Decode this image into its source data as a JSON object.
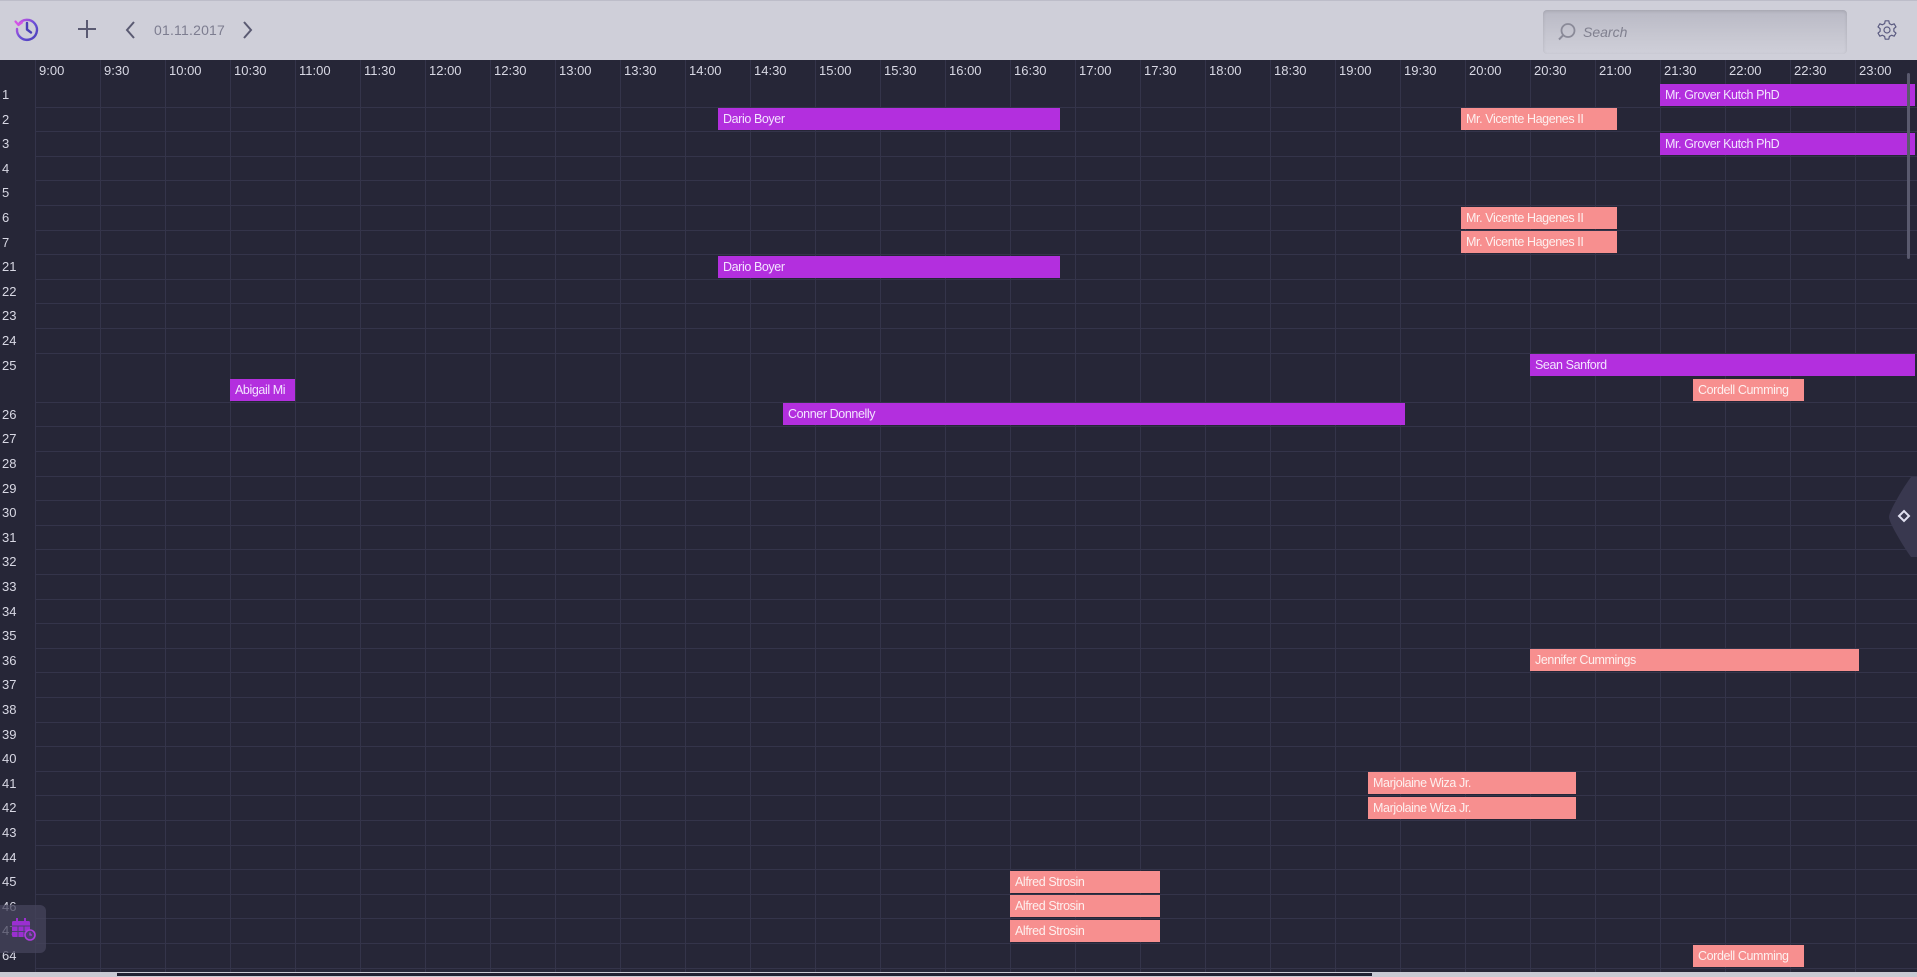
{
  "toolbar": {
    "history_icon": "history-icon",
    "add_icon": "plus-icon",
    "prev_icon": "chevron-left-icon",
    "next_icon": "chevron-right-icon",
    "date": "01.11.2017",
    "search_placeholder": "Search",
    "search_value": "",
    "settings_icon": "gear-icon"
  },
  "colors": {
    "purple_event": "#b32fde",
    "salmon_event": "#f78f8f",
    "background": "#262637",
    "toolbar": "#cfcfd9"
  },
  "timeline": {
    "start": "9:00",
    "slot_minutes": 30,
    "labels": [
      "9:00",
      "9:30",
      "10:00",
      "10:30",
      "11:00",
      "11:30",
      "12:00",
      "12:30",
      "13:00",
      "13:30",
      "14:00",
      "14:30",
      "15:00",
      "15:30",
      "16:00",
      "16:30",
      "17:00",
      "17:30",
      "18:00",
      "18:30",
      "19:00",
      "19:30",
      "20:00",
      "20:30",
      "21:00",
      "21:30",
      "22:00",
      "22:30",
      "23:00"
    ]
  },
  "resources": [
    {
      "label": "1",
      "lanes": 1
    },
    {
      "label": "2",
      "lanes": 1
    },
    {
      "label": "3",
      "lanes": 1
    },
    {
      "label": "4",
      "lanes": 1
    },
    {
      "label": "5",
      "lanes": 1
    },
    {
      "label": "6",
      "lanes": 1
    },
    {
      "label": "7",
      "lanes": 1
    },
    {
      "label": "21",
      "lanes": 1
    },
    {
      "label": "22",
      "lanes": 1
    },
    {
      "label": "23",
      "lanes": 1
    },
    {
      "label": "24",
      "lanes": 1
    },
    {
      "label": "25",
      "lanes": 2
    },
    {
      "label": "26",
      "lanes": 1
    },
    {
      "label": "27",
      "lanes": 1
    },
    {
      "label": "28",
      "lanes": 1
    },
    {
      "label": "29",
      "lanes": 1
    },
    {
      "label": "30",
      "lanes": 1
    },
    {
      "label": "31",
      "lanes": 1
    },
    {
      "label": "32",
      "lanes": 1
    },
    {
      "label": "33",
      "lanes": 1
    },
    {
      "label": "34",
      "lanes": 1
    },
    {
      "label": "35",
      "lanes": 1
    },
    {
      "label": "36",
      "lanes": 1
    },
    {
      "label": "37",
      "lanes": 1
    },
    {
      "label": "38",
      "lanes": 1
    },
    {
      "label": "39",
      "lanes": 1
    },
    {
      "label": "40",
      "lanes": 1
    },
    {
      "label": "41",
      "lanes": 1
    },
    {
      "label": "42",
      "lanes": 1
    },
    {
      "label": "43",
      "lanes": 1
    },
    {
      "label": "44",
      "lanes": 1
    },
    {
      "label": "45",
      "lanes": 1
    },
    {
      "label": "46",
      "lanes": 1
    },
    {
      "label": "47",
      "lanes": 1
    },
    {
      "label": "64",
      "lanes": 1
    }
  ],
  "events": [
    {
      "resource": "1",
      "lane": 0,
      "title": "Mr. Grover Kutch PhD",
      "start": "21:30",
      "end": "24:30",
      "color": "purple"
    },
    {
      "resource": "2",
      "lane": 0,
      "title": "Dario Boyer",
      "start": "14:15",
      "end": "16:53",
      "color": "purple"
    },
    {
      "resource": "2",
      "lane": 0,
      "title": "Mr. Vicente Hagenes II",
      "start": "19:58",
      "end": "21:10",
      "color": "salmon"
    },
    {
      "resource": "3",
      "lane": 0,
      "title": "Mr. Grover Kutch PhD",
      "start": "21:30",
      "end": "24:30",
      "color": "purple"
    },
    {
      "resource": "6",
      "lane": 0,
      "title": "Mr. Vicente Hagenes II",
      "start": "19:58",
      "end": "21:10",
      "color": "salmon"
    },
    {
      "resource": "7",
      "lane": 0,
      "title": "Mr. Vicente Hagenes II",
      "start": "19:58",
      "end": "21:10",
      "color": "salmon"
    },
    {
      "resource": "21",
      "lane": 0,
      "title": "Dario Boyer",
      "start": "14:15",
      "end": "16:53",
      "color": "purple"
    },
    {
      "resource": "25",
      "lane": 0,
      "title": "Sean Sanford",
      "start": "20:30",
      "end": "24:30",
      "color": "purple"
    },
    {
      "resource": "25",
      "lane": 1,
      "title": "Abigail Mi",
      "start": "10:30",
      "end": "11:00",
      "color": "purple"
    },
    {
      "resource": "25",
      "lane": 1,
      "title": "Cordell Cumming",
      "start": "21:45",
      "end": "22:36",
      "color": "salmon"
    },
    {
      "resource": "26",
      "lane": 0,
      "title": "Conner Donnelly",
      "start": "14:45",
      "end": "19:32",
      "color": "purple"
    },
    {
      "resource": "36",
      "lane": 0,
      "title": "Jennifer Cummings",
      "start": "20:30",
      "end": "23:02",
      "color": "salmon"
    },
    {
      "resource": "41",
      "lane": 0,
      "title": "Marjolaine Wiza Jr.",
      "start": "19:15",
      "end": "20:51",
      "color": "salmon"
    },
    {
      "resource": "42",
      "lane": 0,
      "title": "Marjolaine Wiza Jr.",
      "start": "19:15",
      "end": "20:51",
      "color": "salmon"
    },
    {
      "resource": "45",
      "lane": 0,
      "title": "Alfred Strosin",
      "start": "16:30",
      "end": "17:39",
      "color": "salmon"
    },
    {
      "resource": "46",
      "lane": 0,
      "title": "Alfred Strosin",
      "start": "16:30",
      "end": "17:39",
      "color": "salmon"
    },
    {
      "resource": "47",
      "lane": 0,
      "title": "Alfred Strosin",
      "start": "16:30",
      "end": "17:39",
      "color": "salmon"
    },
    {
      "resource": "64",
      "lane": 0,
      "title": "Cordell Cumming",
      "start": "21:45",
      "end": "22:36",
      "color": "salmon"
    }
  ],
  "side_panel_toggle_icon": "diamond-icon",
  "floating_button_icon": "calendar-clock-icon"
}
